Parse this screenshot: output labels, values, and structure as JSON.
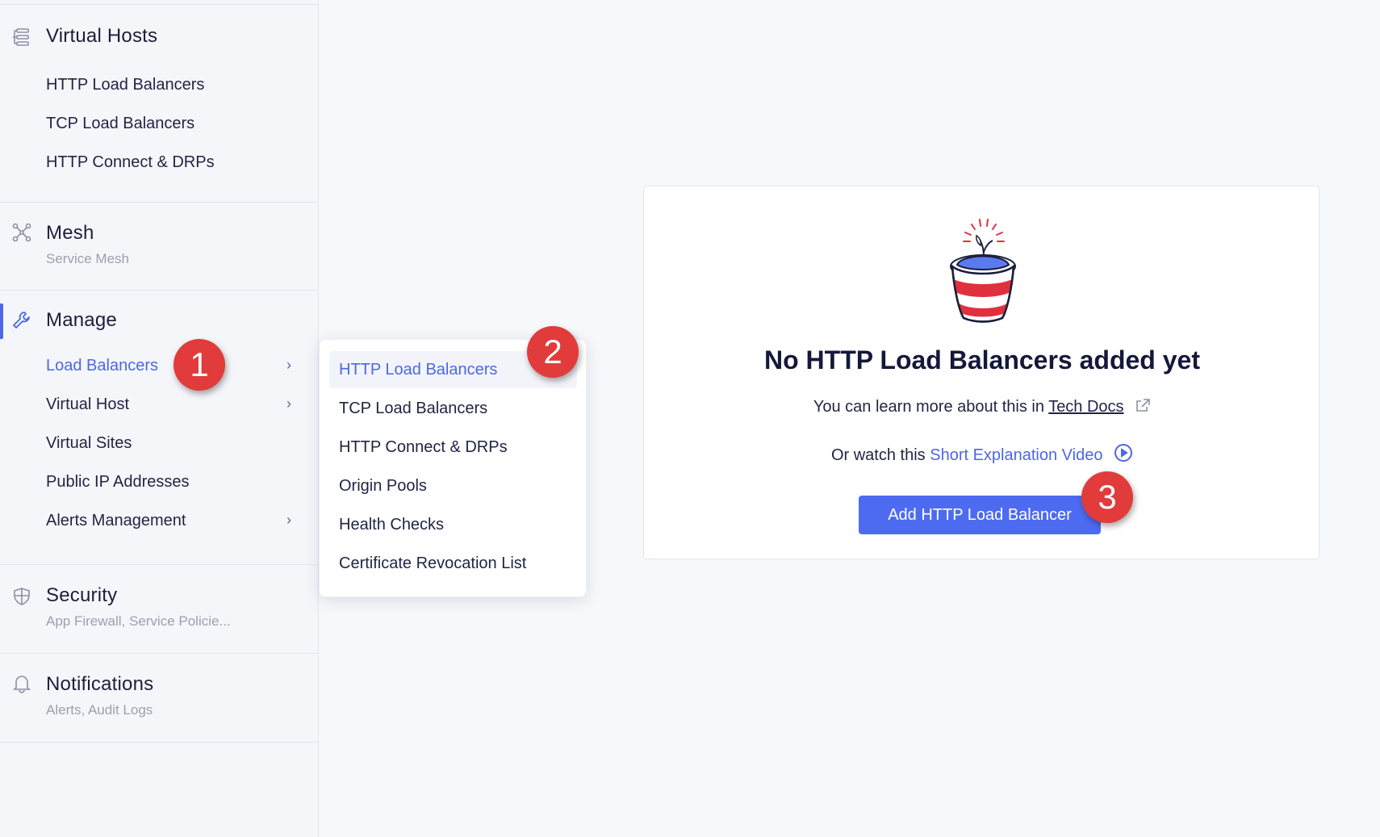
{
  "sidebar": {
    "virtual_hosts": {
      "title": "Virtual Hosts",
      "icon": "virtual-hosts-icon",
      "items": [
        "HTTP Load Balancers",
        "TCP Load Balancers",
        "HTTP Connect & DRPs"
      ]
    },
    "mesh": {
      "title": "Mesh",
      "subtitle": "Service Mesh",
      "icon": "mesh-icon"
    },
    "manage": {
      "title": "Manage",
      "icon": "wrench-icon",
      "items": [
        {
          "label": "Load Balancers",
          "active": true,
          "has_submenu": true
        },
        {
          "label": "Virtual Host",
          "has_submenu": true
        },
        {
          "label": "Virtual Sites"
        },
        {
          "label": "Public IP Addresses"
        },
        {
          "label": "Alerts Management",
          "has_submenu": true
        }
      ]
    },
    "security": {
      "title": "Security",
      "subtitle": "App Firewall, Service Policie...",
      "icon": "shield-icon"
    },
    "notifications": {
      "title": "Notifications",
      "subtitle": "Alerts, Audit Logs",
      "icon": "bell-icon"
    }
  },
  "submenu": {
    "items": [
      {
        "label": "HTTP Load Balancers",
        "active": true
      },
      {
        "label": "TCP Load Balancers"
      },
      {
        "label": "HTTP Connect & DRPs"
      },
      {
        "label": "Origin Pools"
      },
      {
        "label": "Health Checks"
      },
      {
        "label": "Certificate Revocation List"
      }
    ]
  },
  "empty_state": {
    "title": "No HTTP Load Balancers added yet",
    "learn_prefix": "You can learn more about this in ",
    "learn_link": "Tech Docs",
    "watch_prefix": "Or watch this ",
    "watch_link": "Short Explanation Video",
    "button_label": "Add HTTP Load Balancer"
  },
  "callouts": [
    "1",
    "2",
    "3"
  ],
  "colors": {
    "accent": "#4d67e6",
    "button": "#4d6bf1",
    "callout": "#e23b3b"
  }
}
